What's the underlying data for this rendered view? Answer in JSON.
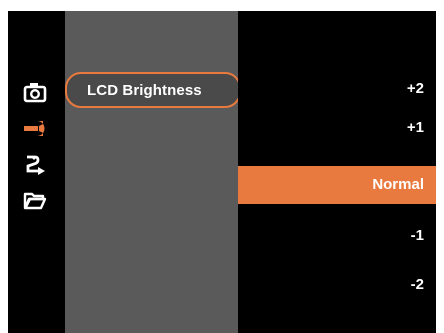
{
  "colors": {
    "accent": "#e97a3f",
    "panel": "#5a5a5a",
    "background": "#000000"
  },
  "sidebar": {
    "icons": [
      {
        "name": "camera-icon",
        "active": false
      },
      {
        "name": "wrench-icon",
        "active": true
      },
      {
        "name": "playback-arrow-icon",
        "active": false
      },
      {
        "name": "folder-icon",
        "active": false
      }
    ]
  },
  "menu": {
    "selected_label": "LCD Brightness"
  },
  "options": {
    "items": [
      "+2",
      "+1",
      "Normal",
      "-1",
      "-2"
    ],
    "selected": "Normal"
  }
}
